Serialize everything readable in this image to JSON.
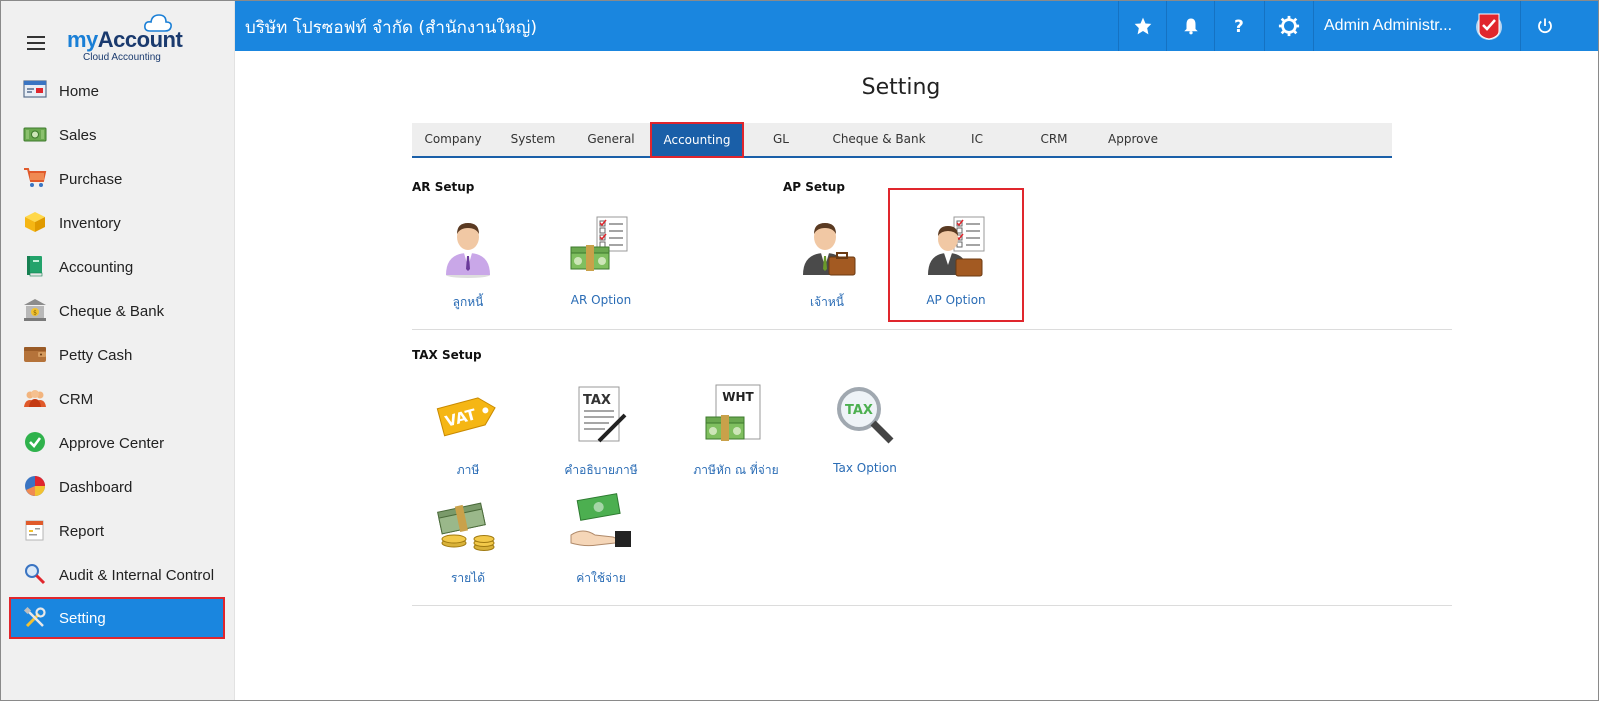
{
  "app": {
    "logo_my": "my",
    "logo_account": "Account",
    "logo_sub": "Cloud Accounting",
    "company": "บริษัท โปรซอฟท์ จำกัด (สำนักงานใหญ่)",
    "user_name": "Admin Administr...",
    "accent": "#1a86df",
    "highlight": "#e0262d"
  },
  "sidebar": {
    "items": [
      {
        "label": "Home",
        "icon": "home-icon"
      },
      {
        "label": "Sales",
        "icon": "money-icon"
      },
      {
        "label": "Purchase",
        "icon": "cart-icon"
      },
      {
        "label": "Inventory",
        "icon": "box-icon"
      },
      {
        "label": "Accounting",
        "icon": "book-icon"
      },
      {
        "label": "Cheque & Bank",
        "icon": "bank-icon"
      },
      {
        "label": "Petty Cash",
        "icon": "wallet-icon"
      },
      {
        "label": "CRM",
        "icon": "people-icon"
      },
      {
        "label": "Approve Center",
        "icon": "check-circle-icon"
      },
      {
        "label": "Dashboard",
        "icon": "pie-chart-icon"
      },
      {
        "label": "Report",
        "icon": "report-icon"
      },
      {
        "label": "Audit & Internal Control",
        "icon": "magnifier-icon"
      },
      {
        "label": "Setting",
        "icon": "tools-icon",
        "active": true
      }
    ]
  },
  "topbar": {
    "icons": [
      "star-icon",
      "bell-icon",
      "help-icon",
      "gear-icon",
      "power-icon"
    ]
  },
  "main": {
    "title": "Setting",
    "tabs": [
      {
        "label": "Company"
      },
      {
        "label": "System"
      },
      {
        "label": "General"
      },
      {
        "label": "Accounting",
        "active": true
      },
      {
        "label": "GL"
      },
      {
        "label": "Cheque & Bank"
      },
      {
        "label": "IC"
      },
      {
        "label": "CRM"
      },
      {
        "label": "Approve"
      }
    ],
    "ar_setup": {
      "title": "AR Setup",
      "items": [
        {
          "label": "ลูกหนี้",
          "icon": "customer-icon"
        },
        {
          "label": "AR Option",
          "icon": "ar-option-icon"
        }
      ]
    },
    "ap_setup": {
      "title": "AP Setup",
      "items": [
        {
          "label": "เจ้าหนี้",
          "icon": "creditor-icon"
        },
        {
          "label": "AP Option",
          "icon": "ap-option-icon",
          "highlighted": true
        }
      ]
    },
    "tax_setup": {
      "title": "TAX Setup",
      "items": [
        {
          "label": "ภาษี",
          "icon": "vat-tag-icon",
          "badge": "VAT"
        },
        {
          "label": "คำอธิบายภาษี",
          "icon": "tax-document-icon",
          "badge": "TAX"
        },
        {
          "label": "ภาษีหัก ณ ที่จ่าย",
          "icon": "wht-icon",
          "badge": "WHT"
        },
        {
          "label": "Tax Option",
          "icon": "tax-magnifier-icon",
          "badge": "TAX"
        },
        {
          "label": "รายได้",
          "icon": "income-icon"
        },
        {
          "label": "ค่าใช้จ่าย",
          "icon": "expense-icon"
        }
      ]
    }
  }
}
